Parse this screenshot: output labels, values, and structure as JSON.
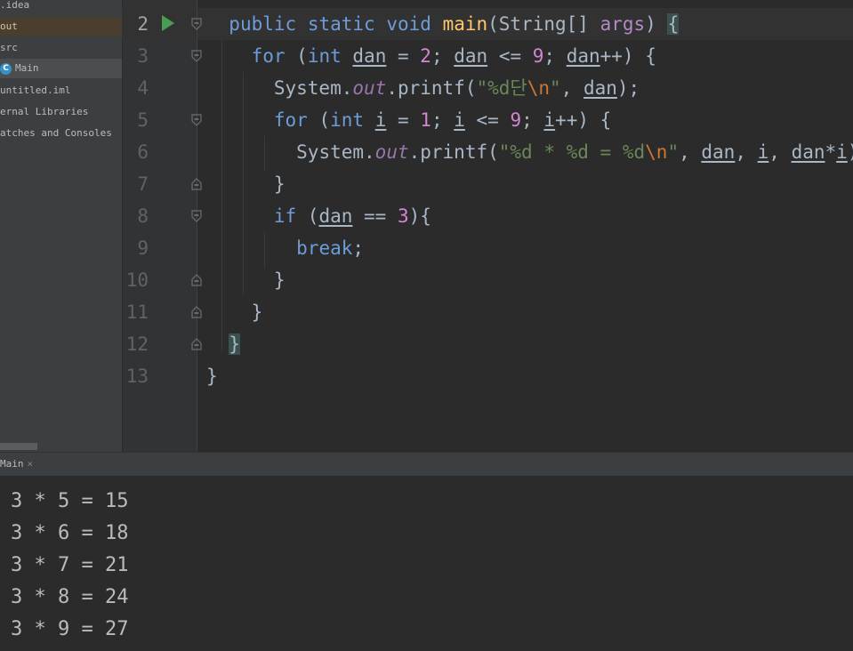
{
  "project_tree": {
    "items": [
      {
        "label": ".idea"
      },
      {
        "label": "out"
      },
      {
        "label": "src"
      },
      {
        "label": "Main"
      },
      {
        "label": "untitled.iml"
      },
      {
        "label": "ernal Libraries"
      },
      {
        "label": "atches and Consoles"
      }
    ]
  },
  "editor": {
    "line_numbers": [
      "2",
      "3",
      "4",
      "5",
      "6",
      "7",
      "8",
      "9",
      "10",
      "11",
      "12",
      "13"
    ],
    "current_line": "2",
    "code": {
      "l2": {
        "kw1": "public",
        "kw2": "static",
        "kw3": "void",
        "fn": "main",
        "p1": "(String[] ",
        "prm": "args",
        "p2": ") ",
        "brace": "{"
      },
      "l3": {
        "kw": "for",
        "p1": " (",
        "kw2": "int",
        "p2": " ",
        "v1": "dan",
        "p3": " = ",
        "n1": "2",
        "p4": "; ",
        "v2": "dan",
        "p5": " <= ",
        "n2": "9",
        "p6": "; ",
        "v3": "dan",
        "p7": "++) {"
      },
      "l4": {
        "p1": "System.",
        "fld": "out",
        "p2": ".printf(",
        "s1": "\"%d단",
        "esc": "\\n",
        "s2": "\"",
        "p3": ", ",
        "v1": "dan",
        "p4": ");"
      },
      "l5": {
        "kw": "for",
        "p1": " (",
        "kw2": "int",
        "p2": " ",
        "v1": "i",
        "p3": " = ",
        "n1": "1",
        "p4": "; ",
        "v2": "i",
        "p5": " <= ",
        "n2": "9",
        "p6": "; ",
        "v3": "i",
        "p7": "++) {"
      },
      "l6": {
        "p1": "System.",
        "fld": "out",
        "p2": ".printf(",
        "s1": "\"%d * %d = %d",
        "esc": "\\n",
        "s2": "\"",
        "p3": ", ",
        "v1": "dan",
        "p4": ", ",
        "v2": "i",
        "p5": ", ",
        "v3": "dan",
        "p6": "*",
        "v4": "i",
        "p7": ");"
      },
      "l7": {
        "t": "}"
      },
      "l8": {
        "kw": "if",
        "p1": " (",
        "v1": "dan",
        "p2": " == ",
        "n1": "3",
        "p3": "){"
      },
      "l9": {
        "kw": "break",
        "p1": ";"
      },
      "l10": {
        "t": "}"
      },
      "l11": {
        "t": "}"
      },
      "l12": {
        "t": "}"
      },
      "l13": {
        "t": "}"
      }
    }
  },
  "run_panel": {
    "tab_label": "Main",
    "close": "×",
    "output": [
      "3 * 5 = 15",
      "3 * 6 = 18",
      "3 * 7 = 21",
      "3 * 8 = 24",
      "3 * 9 = 27"
    ]
  },
  "colors": {
    "keyword": "#6d9cd9",
    "function": "#ffc66d",
    "param": "#b389c5",
    "number": "#d486d4",
    "string": "#6a8759",
    "run": "#499c54"
  }
}
